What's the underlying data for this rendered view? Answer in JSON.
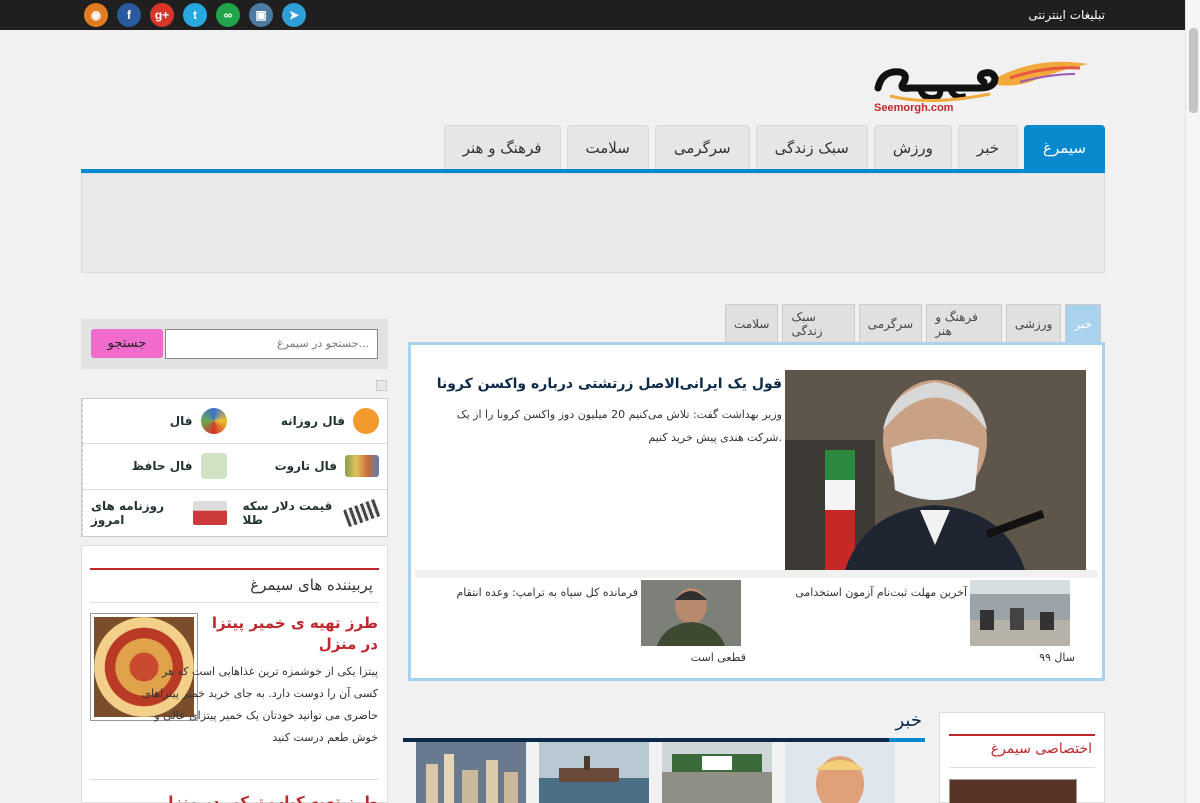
{
  "topbar": {
    "ads_label": "تبلیغات اینترنتی",
    "social_icons": [
      {
        "name": "rss-icon",
        "glyph": "◉",
        "color": "#e07b21"
      },
      {
        "name": "facebook-icon",
        "glyph": "f",
        "color": "#295a9e"
      },
      {
        "name": "google-plus-icon",
        "glyph": "g+",
        "color": "#d6352a"
      },
      {
        "name": "twitter-icon",
        "glyph": "t",
        "color": "#27a8de"
      },
      {
        "name": "aparat-icon",
        "glyph": "∞",
        "color": "#22a44a"
      },
      {
        "name": "instagram-icon",
        "glyph": "▣",
        "color": "#4d7aa0"
      },
      {
        "name": "telegram-icon",
        "glyph": "➤",
        "color": "#2f9fd8"
      }
    ]
  },
  "logo": {
    "text": "Seemorgh.com"
  },
  "nav": {
    "items": [
      "سیمرغ",
      "خبر",
      "ورزش",
      "سبک زندگی",
      "سرگرمی",
      "سلامت",
      "فرهنگ و هنر"
    ],
    "active_color": "#0a8ace"
  },
  "search": {
    "placeholder": "جستجو در سیمرغ...",
    "button_label": "جستجو"
  },
  "fal": {
    "items": [
      {
        "label": "فال",
        "icon": "fal-wheel-icon",
        "color": "#3a6fd0"
      },
      {
        "label": "فال روزانه",
        "icon": "daily-fal-icon",
        "color": "#f29a2e"
      },
      {
        "label": "فال حافظ",
        "icon": "hafez-icon",
        "color": "#6aa84f"
      },
      {
        "label": "فال تاروت",
        "icon": "tarot-cards-icon",
        "color": "#8aa04a"
      },
      {
        "label": "روزنامه های امروز",
        "icon": "newspaper-icon",
        "color": "#cc3a3a"
      },
      {
        "label": "قیمت دلار سکه طلا",
        "icon": "currency-icon",
        "color": "#666666"
      }
    ]
  },
  "popular": {
    "title": "پربیننده های سیمرغ",
    "article_title": "طرز تهیه ی خمیر پیتزا در منزل",
    "article_body": "پیتزا یکی از خوشمزه ترین غذاهایی است که هر کسی آن را دوست دارد. به جای خرید خمیر پیتزاهای حاضری می توانید خودتان یک خمیر پیتزای عالی و خوش طعم درست کنید",
    "next_title": "طرز تهیه کباب ترکی در منزل"
  },
  "category_tabs": [
    "خبر",
    "ورزشی",
    "فرهنگ و هنر",
    "سرگرمی",
    "سبک زندگی",
    "سلامت"
  ],
  "featured": {
    "headline": "قول یک ایرانی‌الاصل زرتشتی درباره واکسن کرونا",
    "lead": "وزیر بهداشت گفت: تلاش می‌کنیم 20 میلیون دوز واکسن کرونا را از یک شرکت هندی پیش خرید کنیم.",
    "sub1_line1": "آخرین مهلت ثبت‌نام آزمون استخدامی",
    "sub1_line2": "سال ۹۹",
    "sub2_line1": "فرمانده کل سپاه به ترامپ: وعده انتقام",
    "sub2_line2": "قطعی است"
  },
  "news_section": {
    "title": "خبر"
  },
  "exclusive": {
    "title": "اختصاصی سیمرغ"
  },
  "colors": {
    "accent": "#0a8ace",
    "brand_red": "#c0272d",
    "search_button": "#f06bcc"
  }
}
